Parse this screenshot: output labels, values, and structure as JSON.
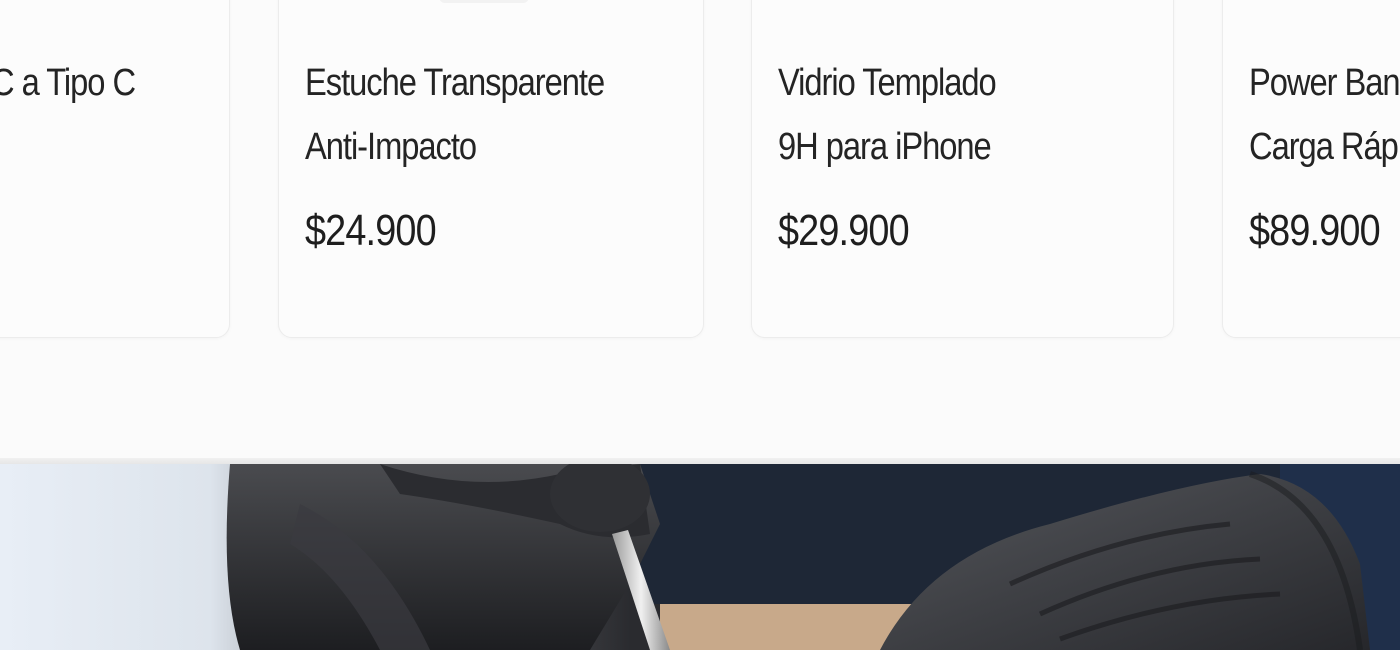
{
  "products": [
    {
      "name_line1": "C a Tipo C",
      "name_line2": "",
      "price": ""
    },
    {
      "name_line1": "Estuche Transparente",
      "name_line2": "Anti-Impacto",
      "price": "$24.900"
    },
    {
      "name_line1": "Vidrio Templado",
      "name_line2": "9H para iPhone",
      "price": "$29.900"
    },
    {
      "name_line1": "Power Ban",
      "name_line2": "Carga Ráp",
      "price": "$89.900"
    }
  ],
  "hero": {
    "image": "repair-technician-gloved-hands-photo"
  }
}
